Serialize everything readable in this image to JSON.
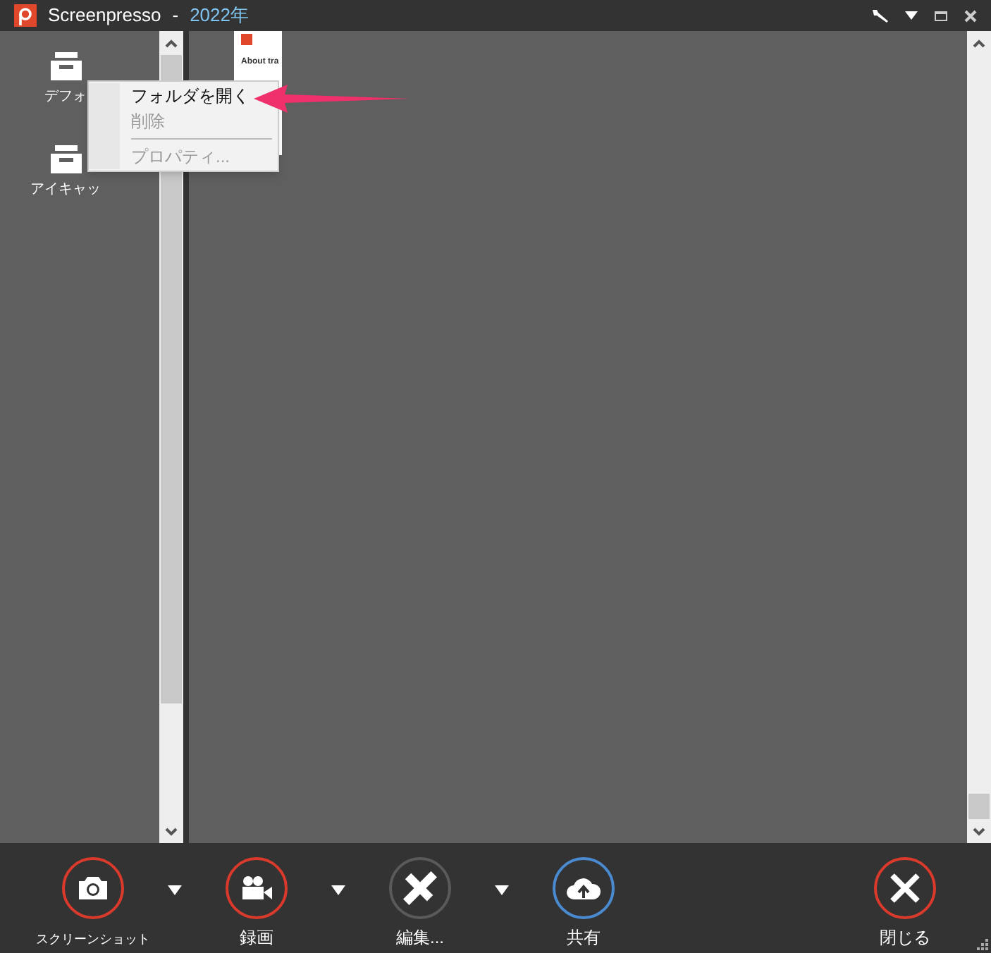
{
  "window": {
    "app_name": "Screenpresso",
    "separator": "-",
    "folder_title": "2022年"
  },
  "folders": [
    {
      "label": "デフォ"
    },
    {
      "label": "アイキャッ"
    }
  ],
  "thumbnail": {
    "caption": "About tra"
  },
  "context_menu": [
    {
      "kind": "item",
      "label": "フォルダを開く",
      "disabled": false
    },
    {
      "kind": "item",
      "label": "削除",
      "disabled": true
    },
    {
      "kind": "separator"
    },
    {
      "kind": "item",
      "label": "プロパティ...",
      "disabled": true
    }
  ],
  "toolbar": [
    {
      "kind": "camera",
      "label": "スクリーンショット",
      "color": "#d93a2b",
      "dropdown": true
    },
    {
      "kind": "video",
      "label": "録画",
      "color": "#d93a2b",
      "dropdown": true
    },
    {
      "kind": "edit",
      "label": "編集...",
      "color": "#5a5a5a",
      "dropdown": true
    },
    {
      "kind": "share",
      "label": "共有",
      "color": "#4a8ad0",
      "dropdown": false
    },
    {
      "kind": "close",
      "label": "閉じる",
      "color": "#d93a2b",
      "dropdown": false
    }
  ]
}
